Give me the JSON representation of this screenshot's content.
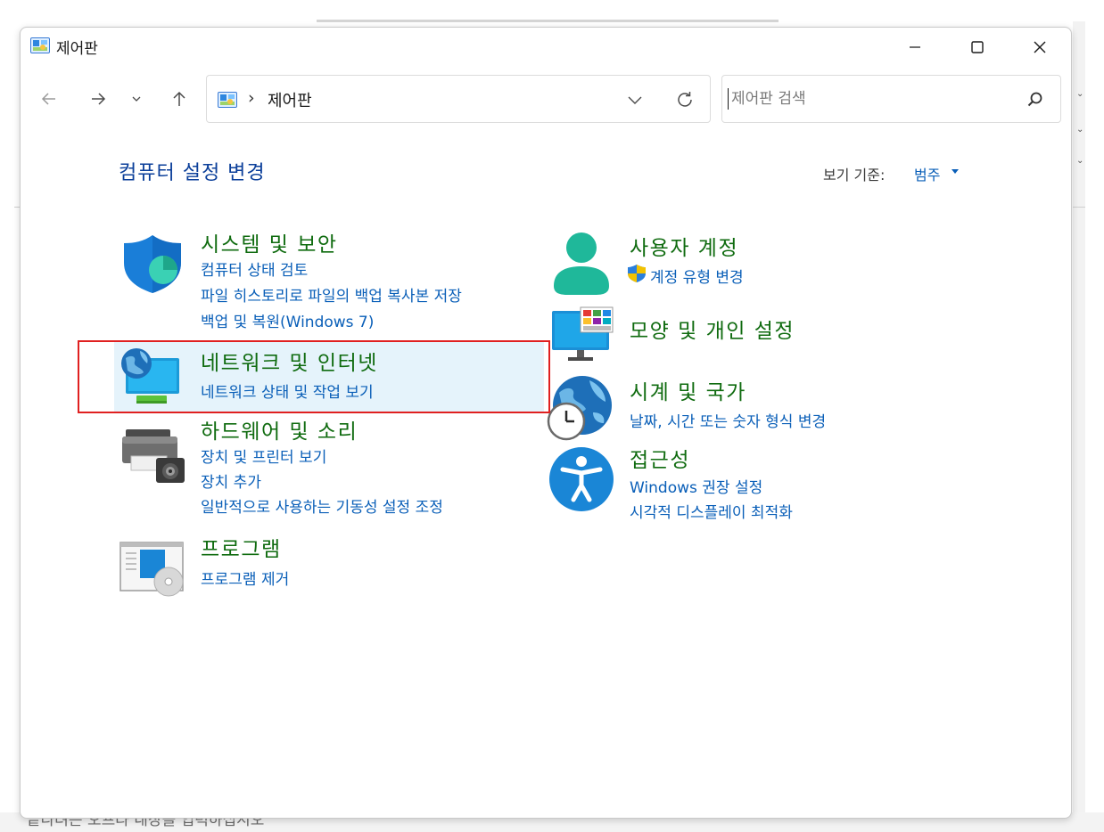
{
  "window": {
    "title": "제어판",
    "minimize_label": "",
    "maximize_label": "",
    "close_label": ""
  },
  "address_bar": {
    "separator": "›",
    "location": "제어판"
  },
  "search": {
    "placeholder": "제어판 검색",
    "value": ""
  },
  "content": {
    "title": "컴퓨터 설정 변경",
    "view_by_label": "보기 기준:",
    "view_by_value": "범주"
  },
  "categories": {
    "system_security": {
      "title": "시스템 및 보안",
      "links": [
        "컴퓨터 상태 검토",
        "파일 히스토리로 파일의 백업 복사본 저장",
        "백업 및 복원(Windows 7)"
      ]
    },
    "network": {
      "title": "네트워크 및 인터넷",
      "links": [
        "네트워크 상태 및 작업 보기"
      ]
    },
    "hardware": {
      "title": "하드웨어 및 소리",
      "links": [
        "장치 및 프린터 보기",
        "장치 추가",
        "일반적으로 사용하는 기동성 설정 조정"
      ]
    },
    "programs": {
      "title": "프로그램",
      "links": [
        "프로그램 제거"
      ]
    },
    "user_accounts": {
      "title": "사용자 계정",
      "links": [
        "계정 유형 변경"
      ]
    },
    "appearance": {
      "title": "모양 및 개인 설정",
      "links": []
    },
    "clock_region": {
      "title": "시계 및 국가",
      "links": [
        "날짜, 시간 또는 숫자 형식 변경"
      ]
    },
    "ease_of_access": {
      "title": "접근성",
      "links": [
        "Windows 권장 설정",
        "시각적 디스플레이 최적화"
      ]
    }
  },
  "background": {
    "bottom_text": "끝나려는 오프라 내장을 입력하십시오"
  },
  "colors": {
    "category_title": "#0f6b0f",
    "link": "#0a5fb8",
    "page_title": "#0b3f9a",
    "highlight": "#e5f3fb",
    "annotation": "#e02020"
  },
  "icons": {
    "window": "control-panel-icon",
    "system_security": "shield-icon",
    "network": "globe-monitor-icon",
    "hardware": "printer-speaker-icon",
    "programs": "program-disc-icon",
    "user_accounts": "user-icon",
    "uac": "uac-shield-icon",
    "appearance": "monitor-palette-icon",
    "clock_region": "globe-clock-icon",
    "ease_of_access": "accessibility-icon"
  }
}
